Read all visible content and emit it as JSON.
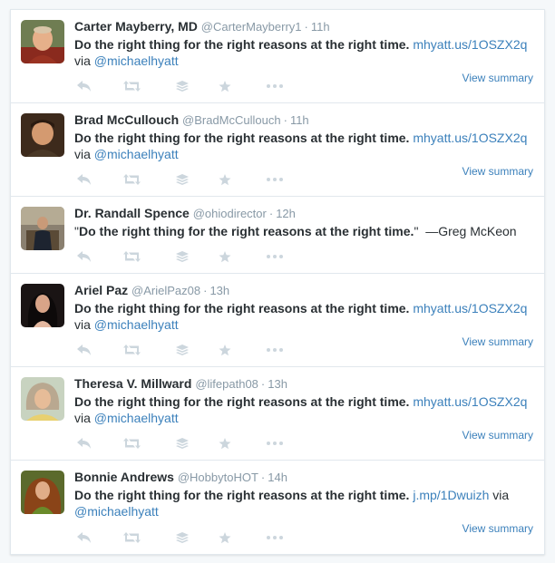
{
  "tweets": [
    {
      "name": "Carter Mayberry, MD",
      "handle": "@CarterMayberry1",
      "time": "11h",
      "text": "Do the right thing for the right reasons at the right time.",
      "link": "mhyatt.us/1OSZX2q",
      "via": "via",
      "mention": "@michaelhyatt",
      "summary": "View summary"
    },
    {
      "name": "Brad McCullouch",
      "handle": "@BradMcCullouch",
      "time": "11h",
      "text": "Do the right thing for the right reasons at the right time.",
      "link": "mhyatt.us/1OSZX2q",
      "via": "via",
      "mention": "@michaelhyatt",
      "summary": "View summary"
    },
    {
      "name": "Dr. Randall Spence",
      "handle": "@ohiodirector",
      "time": "12h",
      "quote_open": "\"",
      "text": "Do the right thing for the right reasons at the right time.",
      "quote_close": "\"",
      "attribution": "—Greg McKeon"
    },
    {
      "name": "Ariel Paz",
      "handle": "@ArielPaz08",
      "time": "13h",
      "text": "Do the right thing for the right reasons at the right time.",
      "link": "mhyatt.us/1OSZX2q",
      "via": "via",
      "mention": "@michaelhyatt",
      "summary": "View summary"
    },
    {
      "name": "Theresa V. Millward",
      "handle": "@lifepath08",
      "time": "13h",
      "text": "Do the right thing for the right reasons at the right time.",
      "link": "mhyatt.us/1OSZX2q",
      "via": "via",
      "mention": "@michaelhyatt",
      "summary": "View summary"
    },
    {
      "name": "Bonnie Andrews",
      "handle": "@HobbytoHOT",
      "time": "14h",
      "text": "Do the right thing for the right reasons at the right time.",
      "link": "j.mp/1Dwuizh",
      "via": "via",
      "mention": "@michaelhyatt",
      "summary": "View summary"
    }
  ],
  "separator": "·",
  "icons": {
    "reply": "reply-icon",
    "retweet": "retweet-icon",
    "buffer": "buffer-icon",
    "favorite": "star-icon",
    "more": "more-icon"
  },
  "colors": {
    "link": "#3b80bb",
    "muted": "#8899a6",
    "text": "#292f33",
    "action_icon": "#ccd6dd",
    "border": "#e1e8ed"
  }
}
